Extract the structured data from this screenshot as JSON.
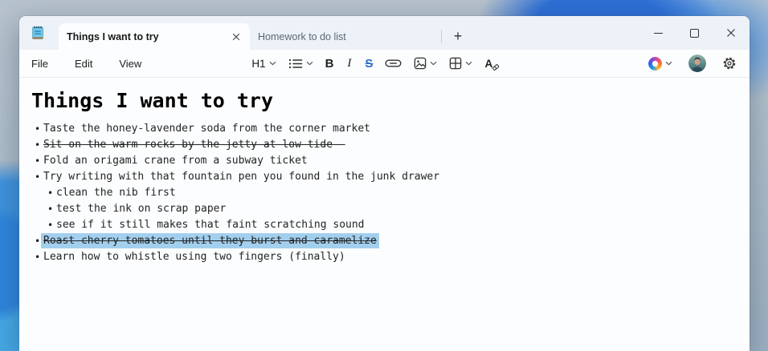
{
  "colors": {
    "selection_highlight": "#a3cfee",
    "strikethrough_button_active": "#2a6cc9",
    "titlebar_background": "#edf1f8"
  },
  "titlebar": {
    "app_icon": "notepad-icon",
    "tabs": [
      {
        "label": "Things I want to try",
        "active": true
      },
      {
        "label": "Homework to do list",
        "active": false
      }
    ],
    "new_tab_glyph": "+",
    "controls": {
      "minimize": "minimize",
      "maximize": "maximize",
      "close": "close"
    }
  },
  "menubar": {
    "items": [
      "File",
      "Edit",
      "View"
    ]
  },
  "toolbar": {
    "heading_level": "H1",
    "bold_glyph": "B",
    "italic_glyph": "I",
    "strike_glyph": "S",
    "clear_format_glyph": "A",
    "strikethrough_active": true,
    "icons": [
      "bullet-list-icon",
      "bold-icon",
      "italic-icon",
      "strikethrough-icon",
      "link-icon",
      "image-icon",
      "table-icon",
      "clear-formatting-icon",
      "copilot-icon",
      "profile-avatar",
      "settings-gear-icon"
    ]
  },
  "doc": {
    "title": "Things I want to try",
    "bullet_glyph": "•",
    "items": [
      {
        "text": "Taste the honey-lavender soda from the corner market",
        "level": 1,
        "strike": false,
        "selected": false
      },
      {
        "text": "Sit on the warm rocks by the jetty at low tide",
        "level": 1,
        "strike": true,
        "strike_extends": true,
        "selected": false
      },
      {
        "text": "Fold an origami crane from a subway ticket",
        "level": 1,
        "strike": false,
        "selected": false
      },
      {
        "text": "Try writing with that fountain pen you found in the junk drawer",
        "level": 1,
        "strike": false,
        "selected": false
      },
      {
        "text": "clean the nib first",
        "level": 2,
        "strike": false,
        "selected": false
      },
      {
        "text": "test the ink on scrap paper",
        "level": 2,
        "strike": false,
        "selected": false
      },
      {
        "text": "see if it still makes that faint scratching sound",
        "level": 2,
        "strike": false,
        "selected": false
      },
      {
        "text": "Roast cherry tomatoes until they burst and caramelize",
        "level": 1,
        "strike": true,
        "selected": true
      },
      {
        "text": "Learn how to whistle using two fingers (finally)",
        "level": 1,
        "strike": false,
        "selected": false
      }
    ]
  }
}
